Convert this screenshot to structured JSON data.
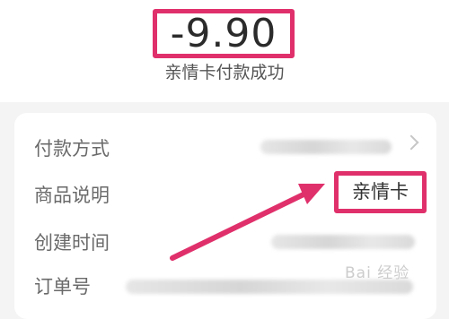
{
  "payment": {
    "amount": "-9.90",
    "status": "亲情卡付款成功"
  },
  "details": {
    "rows": [
      {
        "label": "付款方式"
      },
      {
        "label": "商品说明",
        "value": "亲情卡"
      },
      {
        "label": "创建时间"
      },
      {
        "label": "订单号"
      }
    ]
  },
  "watermark": "Bai 经验",
  "colors": {
    "highlight": "#e0306b",
    "background": "#f4f4f4",
    "card": "#ffffff"
  }
}
